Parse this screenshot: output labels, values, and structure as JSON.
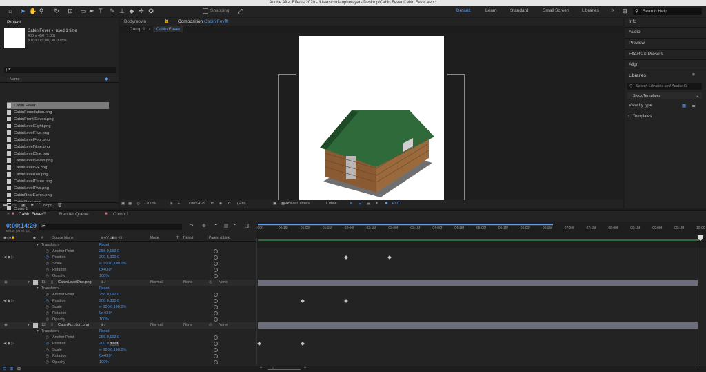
{
  "app_title": "Adobe After Effects 2020 - /Users/christopherayers/Desktop/Cabin Fever/Cabin Fever.aep *",
  "toolbar": {
    "snapping_label": "Snapping",
    "workspaces": [
      "Default",
      "Learn",
      "Standard",
      "Small Screen",
      "Libraries"
    ],
    "active_workspace": "Default",
    "search_placeholder": "Search Help"
  },
  "project": {
    "tab": "Project",
    "item_name": "Cabin Fever ▾",
    "item_used": ", used 1 time",
    "item_size": "400 x 450 (1.00)",
    "item_duration": "Δ 0;00;15;00, 30.00 fps",
    "search_placeholder": "ρ▾",
    "column_name": "Name",
    "files": [
      "Cabin Fever",
      "CabinFoundation.png",
      "CabinFront Eaves.png",
      "CabinLevelEight.png",
      "CabinLevelFive.png",
      "CabinLevelFour.png",
      "CabinLevelNine.png",
      "CabinLevelOne.png",
      "CabinLevelSeven.png",
      "CabinLevelSix.png",
      "CabinLevelTen.png",
      "CabinLevelThree.png",
      "CabinLevelTwo.png",
      "CabinRearEaves.png",
      "CabinRoof.png",
      "Comp 1"
    ],
    "bpc": "8 bpc"
  },
  "composition": {
    "tab_bodymovin": "Bodymovin",
    "tab_prefix": "Composition",
    "tab_name": "Cabin Fever",
    "breadcrumb_1": "Comp 1",
    "breadcrumb_2": "Cabin Fever",
    "zoom": "200%",
    "timecode": "0:00:14:29",
    "resolution": "(Full)",
    "camera": "Active Camera",
    "view": "1 View",
    "exposure": "+0.0"
  },
  "right_panel": {
    "items": [
      "Info",
      "Audio",
      "Preview",
      "Effects & Presets",
      "Align"
    ],
    "libraries_title": "Libraries",
    "libraries_search": "Search Libraries and Adobe St",
    "stock_dropdown": "Stock Templates",
    "view_by": "View by type",
    "templates": "Templates"
  },
  "timeline": {
    "tabs": [
      "Cabin Fever",
      "Render Queue",
      "Comp 1"
    ],
    "timecode": "0:00:14:29",
    "frame_info": "00449 (30.00 fps)",
    "col_source": "Source Name",
    "col_mode": "Mode",
    "col_t": "T",
    "col_trkmat": "TrkMat",
    "col_parent": "Parent & Link",
    "ruler": [
      ":00f",
      "00:15f",
      "01:00f",
      "01:15f",
      "02:00f",
      "02:15f",
      "03:00f",
      "03:15f",
      "04:00f",
      "04:15f",
      "05:00f",
      "05:15f",
      "06:00f",
      "06:15f",
      "07:00f",
      "07:15f",
      "08:00f",
      "08:15f",
      "09:00f",
      "09:15f",
      "10:00"
    ],
    "transform": "Transform",
    "reset": "Reset",
    "props": {
      "anchor": "Anchor Point",
      "position": "Position",
      "scale": "Scale",
      "rotation": "Rotation",
      "opacity": "Opacity"
    },
    "group1": {
      "anchor": "256.0,192.0",
      "position": "200.5,300.0",
      "scale": "∞ 100.0,100.0%",
      "rotation": "0x+0.0°",
      "opacity": "100%"
    },
    "layer11": {
      "num": "11",
      "name": "CabinLevelOne.png",
      "mode": "Normal",
      "trkmat": "None",
      "parent": "None",
      "anchor": "256.0,192.0",
      "position": "200.0,300.0",
      "scale": "∞ 100.0,100.0%",
      "rotation": "0x+0.0°",
      "opacity": "100%"
    },
    "layer12": {
      "num": "12",
      "name": "CabinFo...tion.png",
      "mode": "Normal",
      "trkmat": "None",
      "parent": "None",
      "anchor": "256.0,192.0",
      "position_a": "200.0,",
      "position_b": "300.0",
      "scale": "∞ 100.0,100.0%",
      "rotation": "0x+0.0°",
      "opacity": "100%"
    },
    "toggle_label": "Toggle Switches / Modes"
  },
  "colors": {
    "accent": "#4f95e8",
    "roof": "#2f6b3a",
    "log": "#8a5a33"
  }
}
